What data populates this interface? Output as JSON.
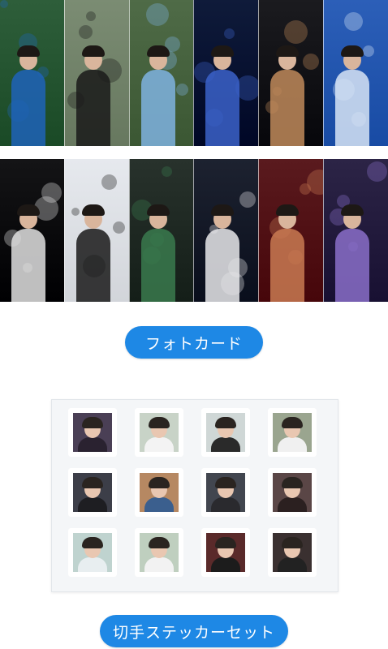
{
  "photocard_section": {
    "label": "フォトカード",
    "row1": [
      {
        "name": "card-umbrella-boy",
        "bg": "#2e5e3a",
        "accent": "#1f63b8"
      },
      {
        "name": "card-girl-hair",
        "bg": "#7b8c73",
        "accent": "#1a1a1a"
      },
      {
        "name": "card-girl-jersey",
        "bg": "#4f6b47",
        "accent": "#7fb3e0"
      },
      {
        "name": "card-stage-bokeh",
        "bg": "#0f1b3a",
        "accent": "#3b62c9"
      },
      {
        "name": "card-drums",
        "bg": "#1b1b1f",
        "accent": "#c08a5a"
      },
      {
        "name": "card-bassist-blue",
        "bg": "#2c5fb8",
        "accent": "#d7e4f5"
      }
    ],
    "row2": [
      {
        "name": "card-singer-mic",
        "bg": "#141416",
        "accent": "#e0e0e0"
      },
      {
        "name": "card-girl-smile",
        "bg": "#e6e9ee",
        "accent": "#1a1a1a"
      },
      {
        "name": "card-guitar-green",
        "bg": "#28322c",
        "accent": "#3a7a4d"
      },
      {
        "name": "card-guitarist-white",
        "bg": "#1d2230",
        "accent": "#e8e8ea"
      },
      {
        "name": "card-drummer-red",
        "bg": "#5a1a1e",
        "accent": "#c97a52"
      },
      {
        "name": "card-bassist-purple",
        "bg": "#2c2446",
        "accent": "#8a6fc9"
      }
    ]
  },
  "sticker_section": {
    "label": "切手ステッカーセット",
    "stamps": [
      {
        "bg": "#4a3f55",
        "body": "#2a2230"
      },
      {
        "bg": "#c8d3c7",
        "body": "#f3f3f3"
      },
      {
        "bg": "#cfd7d6",
        "body": "#2a2a2a"
      },
      {
        "bg": "#9aa58f",
        "body": "#f0f0f0"
      },
      {
        "bg": "#3c3e48",
        "body": "#1e1e22"
      },
      {
        "bg": "#b68862",
        "body": "#3b5f8e"
      },
      {
        "bg": "#42464f",
        "body": "#2a2a2e"
      },
      {
        "bg": "#5a4646",
        "body": "#2b2020"
      },
      {
        "bg": "#bfd3cf",
        "body": "#e8eef0"
      },
      {
        "bg": "#bfcfbf",
        "body": "#f2f2f2"
      },
      {
        "bg": "#5a2a2a",
        "body": "#1c1c1c"
      },
      {
        "bg": "#3a3030",
        "body": "#222"
      }
    ]
  },
  "colors": {
    "pill": "#1e88e5",
    "pill_text": "#ffffff"
  }
}
